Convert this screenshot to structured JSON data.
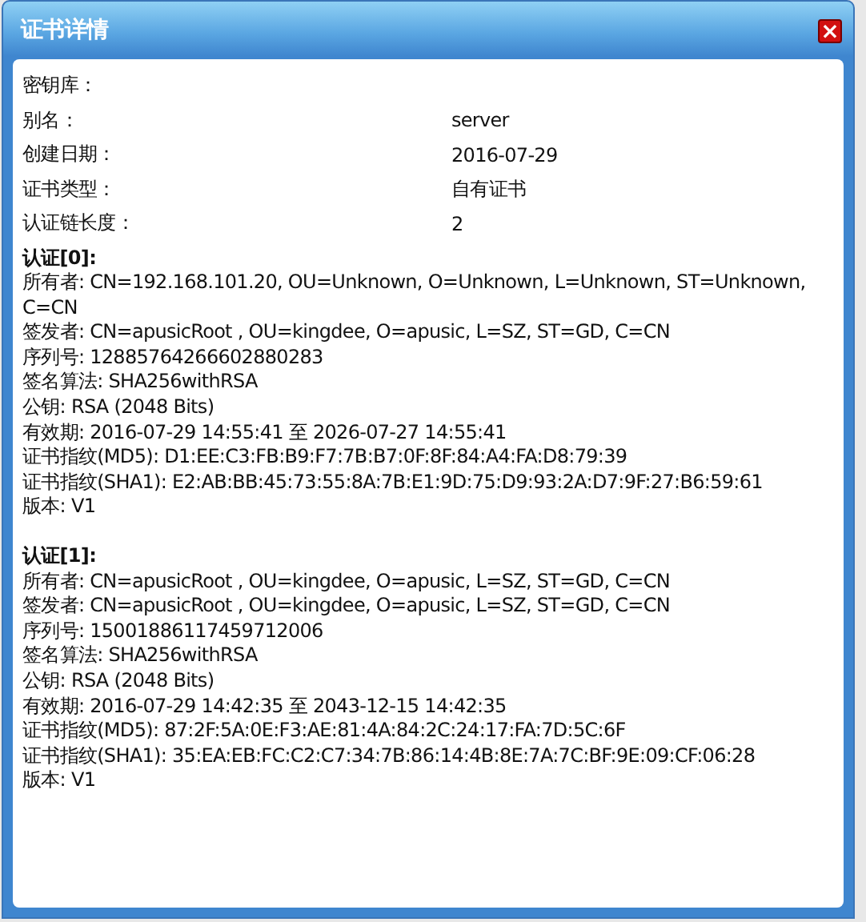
{
  "dialog": {
    "title": "证书详情",
    "close": "×"
  },
  "fields": [
    {
      "label": "密钥库："
    },
    {
      "label": "别名：",
      "value": "server"
    },
    {
      "label": "创建日期：",
      "value": "2016-07-29"
    },
    {
      "label": "证书类型：",
      "value": "自有证书"
    },
    {
      "label": "认证链长度：",
      "value": "2"
    }
  ],
  "certificates": [
    {
      "heading": "认证[0]:",
      "lines": [
        "所有者: CN=192.168.101.20, OU=Unknown, O=Unknown, L=Unknown, ST=Unknown, C=CN",
        "签发者: CN=apusicRoot , OU=kingdee, O=apusic, L=SZ, ST=GD, C=CN",
        "序列号: 12885764266602880283",
        "签名算法: SHA256withRSA",
        "公钥: RSA (2048 Bits)",
        "有效期: 2016-07-29 14:55:41 至 2026-07-27 14:55:41",
        "证书指纹(MD5): D1:EE:C3:FB:B9:F7:7B:B7:0F:8F:84:A4:FA:D8:79:39",
        "证书指纹(SHA1): E2:AB:BB:45:73:55:8A:7B:E1:9D:75:D9:93:2A:D7:9F:27:B6:59:61",
        "版本: V1"
      ]
    },
    {
      "heading": "认证[1]:",
      "lines": [
        "所有者: CN=apusicRoot , OU=kingdee, O=apusic, L=SZ, ST=GD, C=CN",
        "签发者: CN=apusicRoot , OU=kingdee, O=apusic, L=SZ, ST=GD, C=CN",
        "序列号: 15001886117459712006",
        "签名算法: SHA256withRSA",
        "公钥: RSA (2048 Bits)",
        "有效期: 2016-07-29 14:42:35 至 2043-12-15 14:42:35",
        "证书指纹(MD5): 87:2F:5A:0E:F3:AE:81:4A:84:2C:24:17:FA:7D:5C:6F",
        "证书指纹(SHA1): 35:EA:EB:FC:C2:C7:34:7B:86:14:4B:8E:7A:7C:BF:9E:09:CF:06:28",
        "版本: V1"
      ]
    }
  ]
}
